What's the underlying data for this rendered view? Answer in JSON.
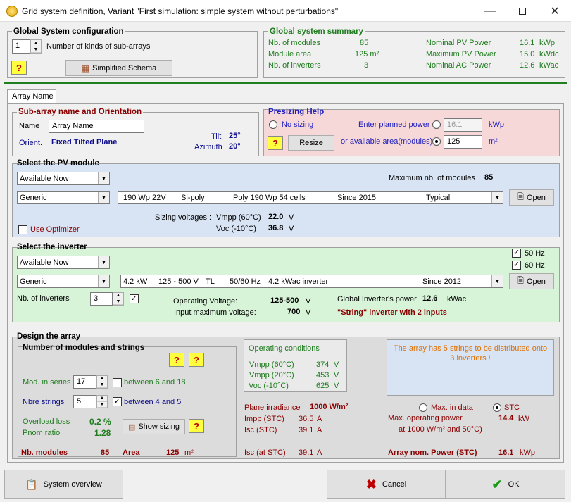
{
  "window": {
    "title": "Grid system definition, Variant    \"First simulation: simple system without perturbations\""
  },
  "global_config": {
    "title": "Global System configuration",
    "kinds_value": "1",
    "kinds_label": "Number of kinds of sub-arrays",
    "schema_button": "Simplified Schema"
  },
  "summary": {
    "title": "Global system summary",
    "nb_modules_label": "Nb. of modules",
    "nb_modules_value": "85",
    "area_label": "Module area",
    "area_value": "125 m²",
    "inverters_label": "Nb. of inverters",
    "inverters_value": "3",
    "pv_power_label": "Nominal PV Power",
    "pv_power_value": "16.1",
    "pv_power_unit": "kWp",
    "max_pv_label": "Maximum PV Power",
    "max_pv_value": "15.0",
    "max_pv_unit": "kWdc",
    "ac_power_label": "Nominal AC Power",
    "ac_power_value": "12.6",
    "ac_power_unit": "kWac"
  },
  "tab": {
    "label": "Array Name"
  },
  "orientation": {
    "title": "Sub-array name and Orientation",
    "name_label": "Name",
    "name_value": "Array Name",
    "orient_label": "Orient.",
    "orient_value": "Fixed Tilted Plane",
    "tilt_label": "Tilt",
    "tilt_value": "25°",
    "azimuth_label": "Azimuth",
    "azimuth_value": "20°"
  },
  "presizing": {
    "title": "Presizing Help",
    "no_sizing": "No sizing",
    "planned_label": "Enter planned power",
    "planned_value": "16.1",
    "planned_unit": "kWp",
    "area_label": "or available area(modules)",
    "area_value": "125",
    "area_unit": "m²",
    "resize_button": "Resize"
  },
  "pv_module": {
    "title": "Select the PV module",
    "availability": "Available Now",
    "max_label": "Maximum nb. of modules",
    "max_value": "85",
    "manufacturer": "Generic",
    "model_power": "190 Wp 22V",
    "model_tech": "Si-poly",
    "model_name": "Poly 190 Wp  54 cells",
    "model_since": "Since 2015",
    "model_type": "Typical",
    "open_button": "Open",
    "sizing_label": "Sizing voltages :",
    "vmpp_label": "Vmpp (60°C)",
    "vmpp_value": "22.0",
    "vmpp_unit": "V",
    "voc_label": "Voc  (-10°C)",
    "voc_value": "36.8",
    "voc_unit": "V",
    "optimizer_label": "Use Optimizer"
  },
  "inverter": {
    "title": "Select the inverter",
    "availability": "Available Now",
    "hz50": "50 Hz",
    "hz60": "60 Hz",
    "manufacturer": "Generic",
    "model_power": "4.2 kW",
    "model_range": "125 - 500 V",
    "model_tl": "TL",
    "model_freq": "50/60 Hz",
    "model_name": "4.2 kWac inverter",
    "model_since": "Since 2012",
    "open_button": "Open",
    "nb_label": "Nb. of inverters",
    "nb_value": "3",
    "op_voltage_label": "Operating Voltage:",
    "op_voltage_value": "125-500",
    "op_voltage_unit": "V",
    "max_voltage_label": "Input maximum voltage:",
    "max_voltage_value": "700",
    "max_voltage_unit": "V",
    "global_power_label": "Global Inverter's power",
    "global_power_value": "12.6",
    "global_power_unit": "kWac",
    "string_note": "\"String\" inverter with 2 inputs"
  },
  "design": {
    "title": "Design the array",
    "strings_title": "Number of modules and strings",
    "series_label": "Mod. in series",
    "series_value": "17",
    "series_between": "between 6 and 18",
    "strings_label": "Nbre strings",
    "strings_value": "5",
    "strings_between": "between 4 and 5",
    "overload_label": "Overload loss",
    "overload_value": "0.2 %",
    "pnom_label": "Pnom ratio",
    "pnom_value": "1.28",
    "show_sizing": "Show sizing",
    "nb_modules_label": "Nb. modules",
    "nb_modules_value": "85",
    "area_label": "Area",
    "area_value": "125",
    "area_unit": "m²",
    "op_title": "Operating conditions",
    "op_vmpp60_label": "Vmpp (60°C)",
    "op_vmpp60_value": "374",
    "op_vmpp20_label": "Vmpp (20°C)",
    "op_vmpp20_value": "453",
    "op_voc_label": "Voc  (-10°C)",
    "op_voc_value": "625",
    "op_unit": "V",
    "irr_label": "Plane irradiance",
    "irr_value": "1000 W/m²",
    "impp_label": "Impp (STC)",
    "impp_value": "36.5",
    "isc_label": "Isc  (STC)",
    "isc_value": "39.1",
    "isc_at_label": "Isc (at STC)",
    "isc_at_value": "39.1",
    "amp_unit": "A",
    "message": "The array has 5 strings to be distributed onto 3 inverters !",
    "max_in_data": "Max. in data",
    "stc": "STC",
    "max_op_label": "Max. operating power",
    "max_op_sub": "at 1000 W/m² and 50°C)",
    "max_op_value": "14.4",
    "max_op_unit": "kW",
    "array_nom_label": "Array nom. Power (STC)",
    "array_nom_value": "16.1",
    "array_nom_unit": "kWp"
  },
  "footer": {
    "overview": "System overview",
    "cancel": "Cancel",
    "ok": "OK"
  },
  "colors": {
    "summary_green": "#1e7c1e",
    "presizing_bg": "#f7d8d8",
    "module_bg": "#d8e4f4",
    "inverter_bg": "#d8f4d8",
    "design_bg": "#dcdcdc"
  }
}
